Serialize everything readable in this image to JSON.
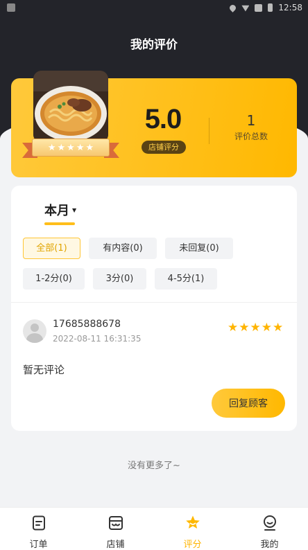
{
  "status_bar": {
    "time": "12:58"
  },
  "page_title": "我的评价",
  "summary": {
    "score": "5.0",
    "score_label": "店铺评分",
    "total_count": "1",
    "total_label": "评价总数"
  },
  "filter": {
    "period": "本月",
    "chips": [
      "全部(1)",
      "有内容(0)",
      "未回复(0)",
      "1-2分(0)",
      "3分(0)",
      "4-5分(1)"
    ],
    "active_chip": "全部(1)"
  },
  "review": {
    "user": "17685888678",
    "time": "2022-08-11 16:31:35",
    "rating": 5,
    "comment": "暂无评论",
    "reply_label": "回复顾客"
  },
  "no_more": "没有更多了~",
  "tabs": [
    {
      "label": "订单",
      "icon": "order-icon"
    },
    {
      "label": "店铺",
      "icon": "shop-icon"
    },
    {
      "label": "评分",
      "icon": "star-badge-icon"
    },
    {
      "label": "我的",
      "icon": "profile-icon"
    }
  ],
  "active_tab": "评分",
  "colors": {
    "accent": "#ffb800",
    "header_bg": "#23242a",
    "page_bg": "#f2f3f5"
  }
}
